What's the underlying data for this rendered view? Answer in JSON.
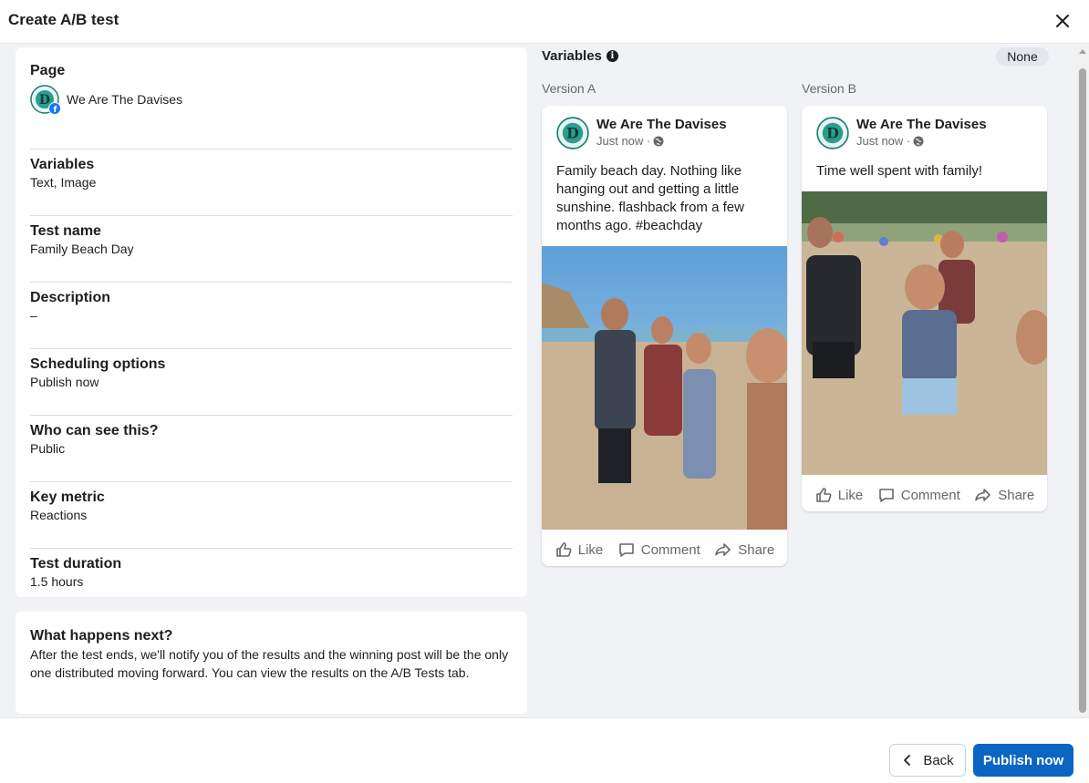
{
  "header": {
    "title": "Create A/B test"
  },
  "summary": {
    "page": {
      "label": "Page",
      "name": "We Are The Davises"
    },
    "rows": [
      {
        "label": "Variables",
        "value": "Text, Image"
      },
      {
        "label": "Test name",
        "value": "Family Beach Day"
      },
      {
        "label": "Description",
        "value": "–"
      },
      {
        "label": "Scheduling options",
        "value": "Publish now"
      },
      {
        "label": "Who can see this?",
        "value": "Public"
      },
      {
        "label": "Key metric",
        "value": "Reactions"
      },
      {
        "label": "Test duration",
        "value": "1.5 hours"
      }
    ]
  },
  "next": {
    "title": "What happens next?",
    "body": "After the test ends, we'll notify you of the results and the winning post will be the only one distributed moving forward. You can view the results on the A/B Tests tab."
  },
  "preview": {
    "variables_label": "Variables",
    "selected_variable": "None",
    "versions": [
      {
        "label": "Version A",
        "page_name": "We Are The Davises",
        "time": "Just now ·",
        "text": "Family beach day. Nothing like hanging out and getting a little sunshine. flashback from a few months ago. #beachday",
        "actions": [
          "Like",
          "Comment",
          "Share"
        ]
      },
      {
        "label": "Version B",
        "page_name": "We Are The Davises",
        "time": "Just now ·",
        "text": "Time well spent with family!",
        "actions": [
          "Like",
          "Comment",
          "Share"
        ]
      }
    ]
  },
  "footer": {
    "back": "Back",
    "publish": "Publish now"
  },
  "colors": {
    "primary": "#0a66c2",
    "background": "#f0f2f5",
    "logo_teal": "#2a9d8f"
  }
}
